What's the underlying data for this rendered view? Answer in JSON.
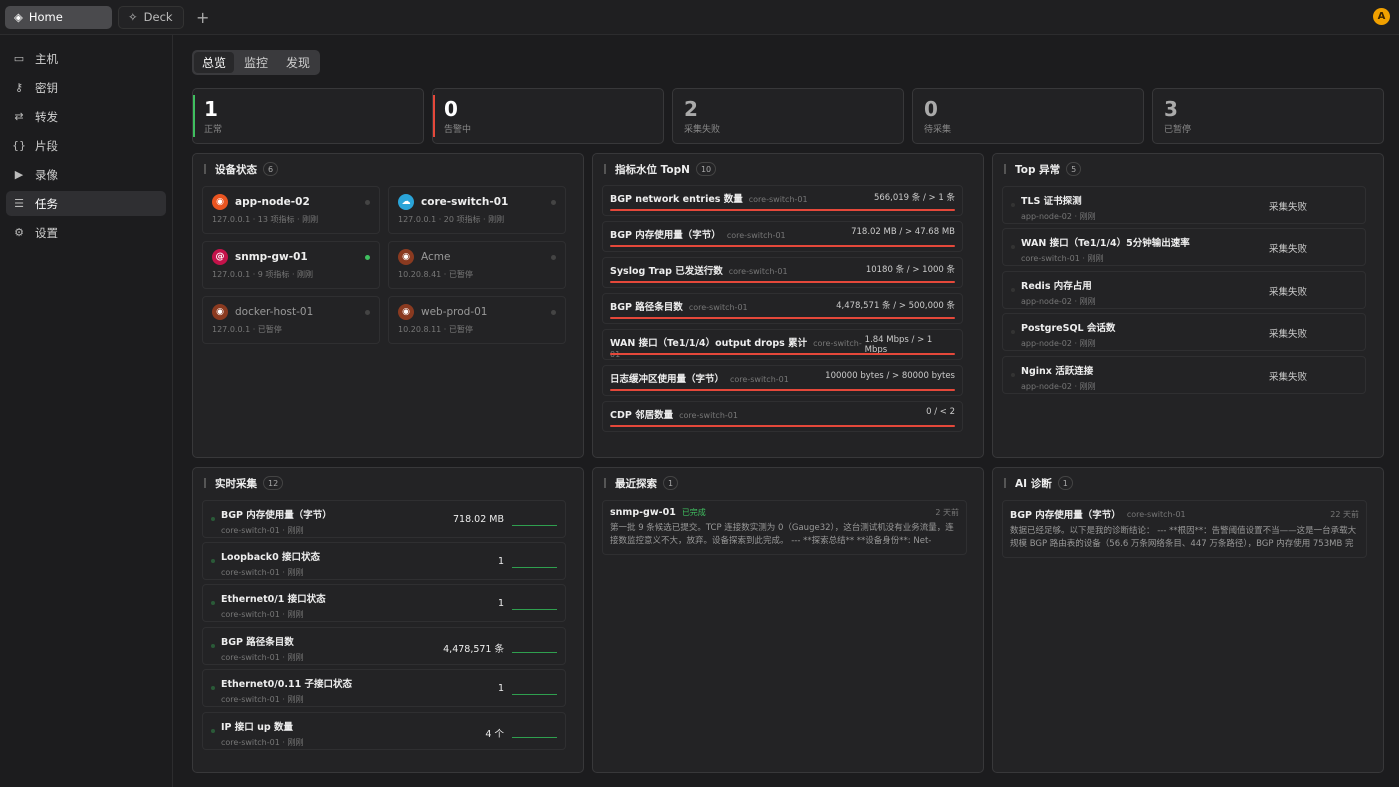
{
  "tabs": [
    {
      "label": "Home"
    },
    {
      "label": "Deck"
    }
  ],
  "avatar": "A",
  "sidebar": {
    "items": [
      {
        "label": "主机",
        "icon": "monitor-icon"
      },
      {
        "label": "密钥",
        "icon": "key-icon"
      },
      {
        "label": "转发",
        "icon": "forward-icon"
      },
      {
        "label": "片段",
        "icon": "code-icon"
      },
      {
        "label": "录像",
        "icon": "video-icon"
      },
      {
        "label": "任务",
        "icon": "task-icon"
      },
      {
        "label": "设置",
        "icon": "gear-icon"
      }
    ]
  },
  "segments": [
    "总览",
    "监控",
    "发现"
  ],
  "stats": [
    {
      "value": "1",
      "label": "正常"
    },
    {
      "value": "0",
      "label": "告警中"
    },
    {
      "value": "2",
      "label": "采集失败"
    },
    {
      "value": "0",
      "label": "待采集"
    },
    {
      "value": "3",
      "label": "已暂停"
    }
  ],
  "device_panel": {
    "title": "设备状态",
    "count": "6",
    "devices": [
      {
        "name": "app-node-02",
        "sub": "127.0.0.1 · 13 项指标 · 刚刚",
        "color": "#e95420"
      },
      {
        "name": "core-switch-01",
        "sub": "127.0.0.1 · 20 项指标 · 刚刚",
        "color": "#2aa4d8"
      },
      {
        "name": "snmp-gw-01",
        "sub": "127.0.0.1 · 9 项指标 · 刚刚",
        "color": "#c4124a"
      },
      {
        "name": "Acme",
        "sub": "10.20.8.41 · 已暂停",
        "color": "#8a3a20"
      },
      {
        "name": "docker-host-01",
        "sub": "127.0.0.1 · 已暂停",
        "color": "#8a3a20"
      },
      {
        "name": "web-prod-01",
        "sub": "10.20.8.11 · 已暂停",
        "color": "#8a3a20"
      }
    ]
  },
  "topn_panel": {
    "title": "指标水位 TopN",
    "count": "10",
    "rows": [
      {
        "name": "BGP network entries 数量",
        "host": "core-switch-01",
        "value": "566,019 条 / > 1 条"
      },
      {
        "name": "BGP 内存使用量（字节）",
        "host": "core-switch-01",
        "value": "718.02 MB / > 47.68 MB"
      },
      {
        "name": "Syslog Trap 已发送行数",
        "host": "core-switch-01",
        "value": "10180 条 / > 1000 条"
      },
      {
        "name": "BGP 路径条目数",
        "host": "core-switch-01",
        "value": "4,478,571 条 / > 500,000 条"
      },
      {
        "name": "WAN 接口（Te1/1/4）output drops 累计",
        "host": "core-switch-01",
        "value": "1.84 Mbps / > 1 Mbps"
      },
      {
        "name": "日志缓冲区使用量（字节）",
        "host": "core-switch-01",
        "value": "100000 bytes / > 80000 bytes"
      },
      {
        "name": "CDP 邻居数量",
        "host": "core-switch-01",
        "value": "0 / < 2"
      }
    ]
  },
  "anomaly_panel": {
    "title": "Top 异常",
    "count": "5",
    "rows": [
      {
        "name": "TLS 证书探测",
        "sub": "app-node-02 · 刚刚",
        "status": "采集失败"
      },
      {
        "name": "WAN 接口（Te1/1/4）5分钟输出速率",
        "sub": "core-switch-01 · 刚刚",
        "status": "采集失败"
      },
      {
        "name": "Redis 内存占用",
        "sub": "app-node-02 · 刚刚",
        "status": "采集失败"
      },
      {
        "name": "PostgreSQL 会话数",
        "sub": "app-node-02 · 刚刚",
        "status": "采集失败"
      },
      {
        "name": "Nginx 活跃连接",
        "sub": "app-node-02 · 刚刚",
        "status": "采集失败"
      }
    ]
  },
  "realtime_panel": {
    "title": "实时采集",
    "count": "12",
    "rows": [
      {
        "name": "BGP 内存使用量（字节）",
        "sub": "core-switch-01 · 刚刚",
        "value": "718.02 MB"
      },
      {
        "name": "Loopback0 接口状态",
        "sub": "core-switch-01 · 刚刚",
        "value": "1"
      },
      {
        "name": "Ethernet0/1 接口状态",
        "sub": "core-switch-01 · 刚刚",
        "value": "1"
      },
      {
        "name": "BGP 路径条目数",
        "sub": "core-switch-01 · 刚刚",
        "value": "4,478,571 条"
      },
      {
        "name": "Ethernet0/0.11 子接口状态",
        "sub": "core-switch-01 · 刚刚",
        "value": "1"
      },
      {
        "name": "IP 接口 up 数量",
        "sub": "core-switch-01 · 刚刚",
        "value": "4 个"
      }
    ]
  },
  "discovery_panel": {
    "title": "最近探索",
    "count": "1",
    "card": {
      "host": "snmp-gw-01",
      "status": "已完成",
      "time": "2 天前",
      "text": "第一批 9 条候选已提交。TCP 连接数实测为 0（Gauge32），这台测试机没有业务流量，连接数监控意义不大，放弃。设备探索到此完成。 --- **探索总结** **设备身份**: Net-SNMP..."
    }
  },
  "ai_panel": {
    "title": "AI 诊断",
    "count": "1",
    "card": {
      "title": "BGP 内存使用量（字节）",
      "host": "core-switch-01",
      "time": "22 天前",
      "text": "数据已经足够。以下是我的诊断结论： --- **根因**：告警阈值设置不当——这是一台承载大规模 BGP 路由表的设备（56.6 万条网络条目、447 万条路径），BGP 内存使用 753MB 完全正..."
    }
  }
}
